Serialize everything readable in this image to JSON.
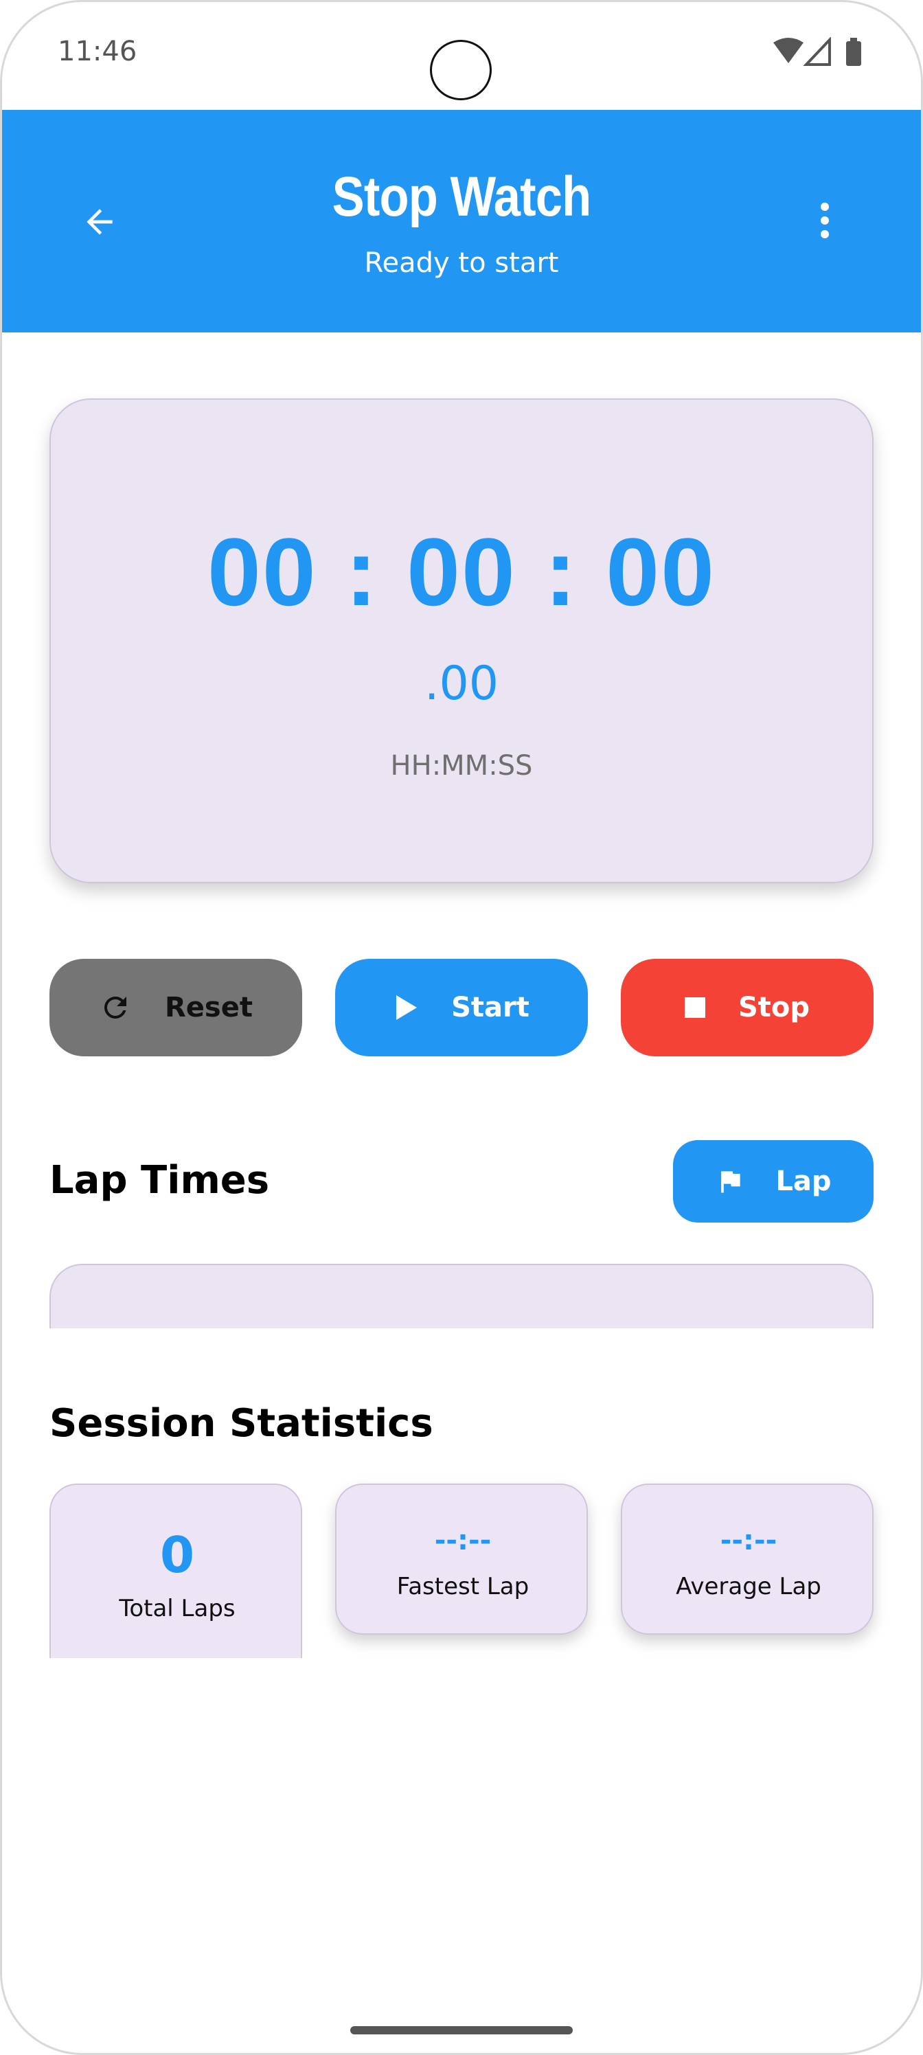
{
  "status_bar": {
    "time": "11:46",
    "icons": [
      "wifi-icon",
      "signal-icon",
      "battery-icon"
    ]
  },
  "app_bar": {
    "title": "Stop Watch",
    "subtitle": "Ready to start",
    "back_icon": "arrow-back-icon",
    "menu_icon": "more-vert-icon"
  },
  "timer": {
    "display": "00 : 00 : 00",
    "milliseconds": ".00",
    "format": "HH:MM:SS"
  },
  "controls": {
    "reset_label": "Reset",
    "start_label": "Start",
    "stop_label": "Stop"
  },
  "laps": {
    "title": "Lap Times",
    "lap_button_label": "Lap",
    "items": []
  },
  "statistics": {
    "title": "Session Statistics",
    "total_laps": {
      "value": "0",
      "label": "Total Laps"
    },
    "fastest_lap": {
      "value": "--:--",
      "label": "Fastest Lap"
    },
    "average_lap": {
      "value": "--:--",
      "label": "Average Lap"
    }
  },
  "colors": {
    "primary": "#2196f3",
    "reset": "#757575",
    "stop": "#f44336",
    "card": "#ebe4f3"
  }
}
